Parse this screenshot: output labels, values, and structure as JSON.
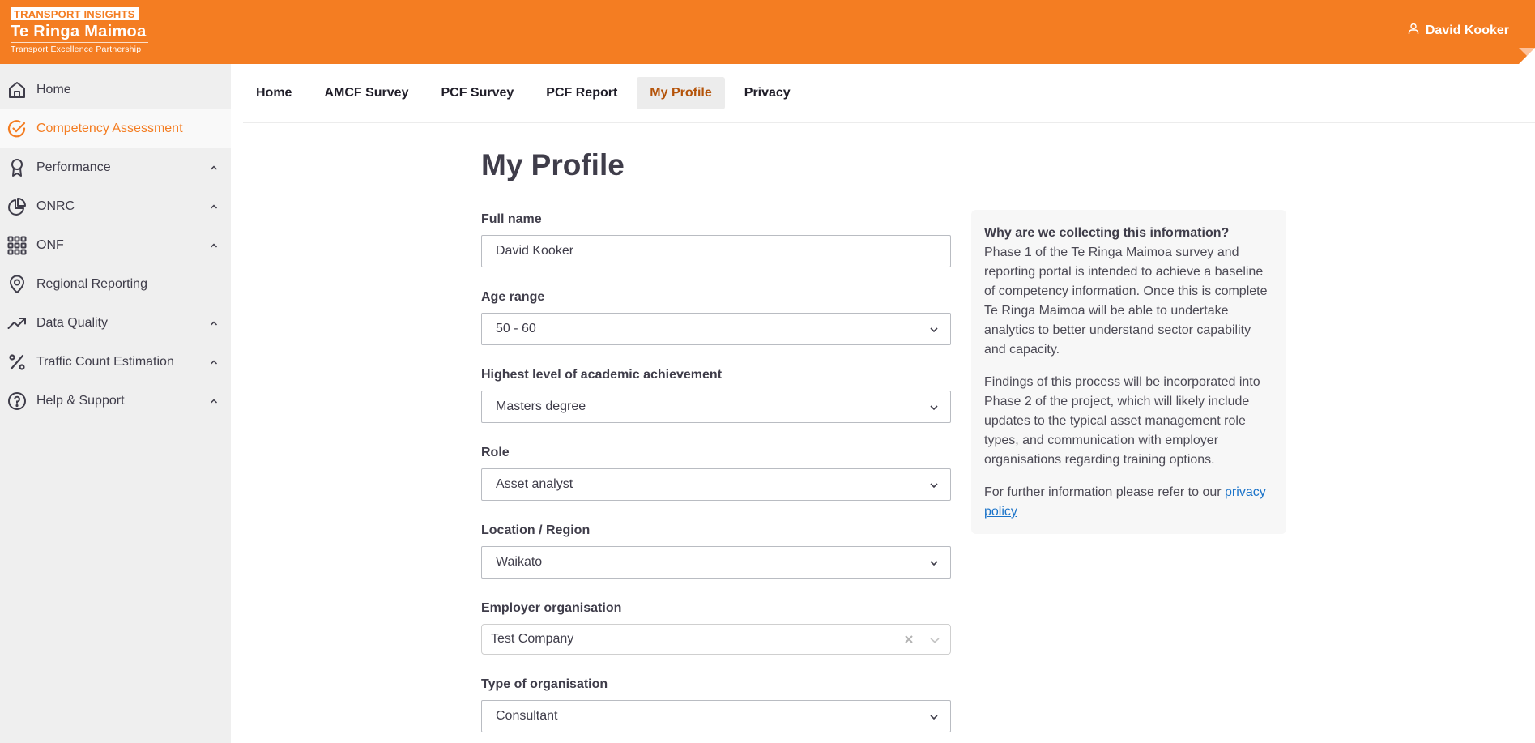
{
  "header": {
    "logo_badge": "TRANSPORT INSIGHTS",
    "logo_title": "Te Ringa Maimoa",
    "logo_subtitle": "Transport Excellence Partnership",
    "user_name": "David Kooker",
    "brand_color": "#f47d22"
  },
  "sidebar": {
    "items": [
      {
        "label": "Home",
        "icon": "home-icon",
        "expandable": false,
        "active": false
      },
      {
        "label": "Competency Assessment",
        "icon": "check-circle-icon",
        "expandable": false,
        "active": true
      },
      {
        "label": "Performance",
        "icon": "award-icon",
        "expandable": true,
        "active": false
      },
      {
        "label": "ONRC",
        "icon": "pie-chart-icon",
        "expandable": true,
        "active": false
      },
      {
        "label": "ONF",
        "icon": "grid-icon",
        "expandable": true,
        "active": false
      },
      {
        "label": "Regional Reporting",
        "icon": "map-pin-icon",
        "expandable": false,
        "active": false
      },
      {
        "label": "Data Quality",
        "icon": "trending-up-icon",
        "expandable": true,
        "active": false
      },
      {
        "label": "Traffic Count Estimation",
        "icon": "percent-icon",
        "expandable": true,
        "active": false
      },
      {
        "label": "Help & Support",
        "icon": "help-circle-icon",
        "expandable": true,
        "active": false
      }
    ]
  },
  "tabs": [
    {
      "label": "Home",
      "active": false
    },
    {
      "label": "AMCF Survey",
      "active": false
    },
    {
      "label": "PCF Survey",
      "active": false
    },
    {
      "label": "PCF Report",
      "active": false
    },
    {
      "label": "My Profile",
      "active": true
    },
    {
      "label": "Privacy",
      "active": false
    }
  ],
  "page": {
    "title": "My Profile",
    "fields": [
      {
        "label": "Full name",
        "type": "text",
        "value": "David Kooker"
      },
      {
        "label": "Age range",
        "type": "select",
        "value": "50 - 60"
      },
      {
        "label": "Highest level of academic achievement",
        "type": "select",
        "value": "Masters degree"
      },
      {
        "label": "Role",
        "type": "select",
        "value": "Asset analyst"
      },
      {
        "label": "Location / Region",
        "type": "select",
        "value": "Waikato"
      },
      {
        "label": "Employer organisation",
        "type": "combobox",
        "value": "Test Company"
      },
      {
        "label": "Type of organisation",
        "type": "select",
        "value": "Consultant"
      }
    ]
  },
  "info": {
    "question": "Why are we collecting this information?",
    "paragraph1": "Phase 1 of the Te Ringa Maimoa survey and reporting portal is intended to achieve a baseline of competency information. Once this is complete Te Ringa Maimoa will be able to undertake analytics to better understand sector capability and capacity.",
    "paragraph2": "Findings of this process will be incorporated into Phase 2 of the project, which will likely include updates to the typical asset management role types, and communication with employer organisations regarding training options.",
    "paragraph3_prefix": "For further information please refer to our ",
    "privacy_link": "privacy policy"
  }
}
